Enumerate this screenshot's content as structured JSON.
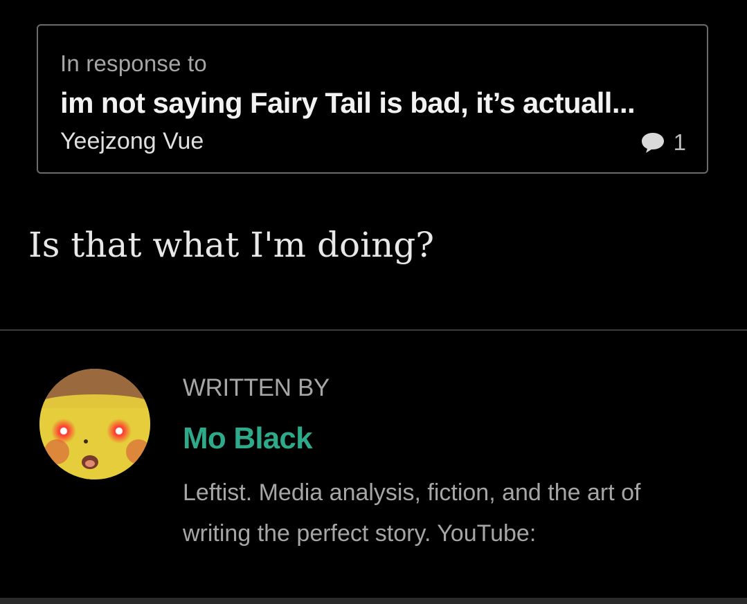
{
  "response_card": {
    "label": "In response to",
    "title": "im not saying Fairy Tail is bad, it’s actuall...",
    "author": "Yeejzong Vue",
    "response_count": "1",
    "icon": "speech-bubble-icon"
  },
  "body": {
    "text": "Is that what I'm doing?"
  },
  "author_section": {
    "written_by_label": "WRITTEN BY",
    "name": "Mo Black",
    "bio": "Leftist. Media analysis, fiction, and the art of writing the perfect story. YouTube:",
    "avatar_icon": "avatar-pikachu-red-eyes",
    "accent_color": "#2ea98a"
  }
}
